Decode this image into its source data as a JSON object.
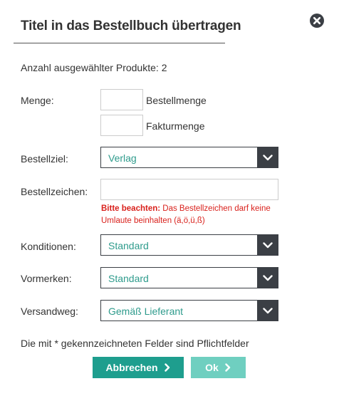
{
  "dialog": {
    "title": "Titel in das Bestellbuch übertragen",
    "count_label": "Anzahl ausgewählter Produkte:",
    "count_value": "2"
  },
  "fields": {
    "menge": {
      "label": "Menge:",
      "bestellmenge_label": "Bestellmenge",
      "fakturmenge_label": "Fakturmenge",
      "bestellmenge_value": "",
      "fakturmenge_value": ""
    },
    "bestellziel": {
      "label": "Bestellziel:",
      "value": "Verlag"
    },
    "bestellzeichen": {
      "label": "Bestellzeichen:",
      "value": "",
      "hint_strong": "Bitte beachten:",
      "hint_text": " Das Bestellzeichen darf keine Umlaute beinhalten (ä,ö,ü,ß)"
    },
    "konditionen": {
      "label": "Konditionen:",
      "value": "Standard"
    },
    "vormerken": {
      "label": "Vormerken:",
      "value": "Standard"
    },
    "versandweg": {
      "label": "Versandweg:",
      "value": "Gemäß Lieferant"
    }
  },
  "required_note": "Die mit * gekennzeichneten Felder sind Pflichtfelder",
  "buttons": {
    "cancel_label": "Abbrechen",
    "ok_label": "Ok"
  },
  "colors": {
    "accent": "#1e9e8e",
    "accent_light": "#6fcfc0",
    "select_dark": "#3b3f45",
    "select_text": "#2e9b8c",
    "hint_red": "#d9211c"
  },
  "icons": {
    "close": "close-circle-icon",
    "dropdown": "chevron-down-icon",
    "button_arrow": "chevron-right-icon"
  }
}
